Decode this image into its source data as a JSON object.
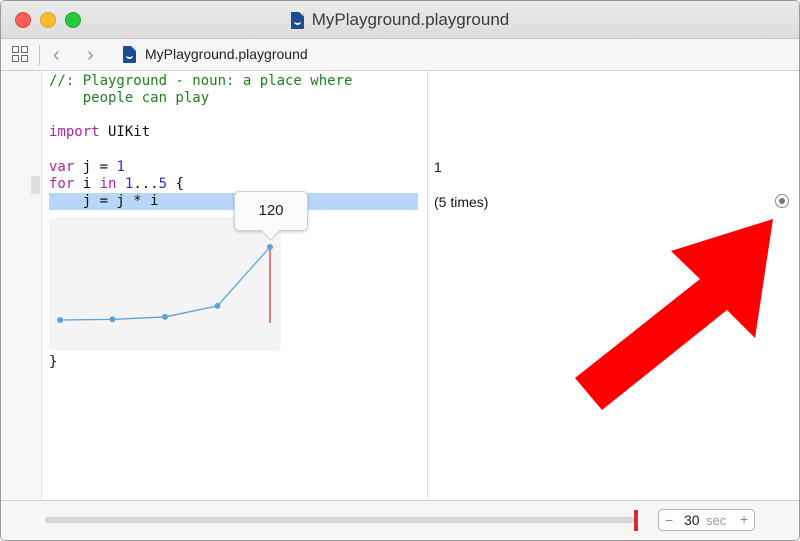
{
  "window": {
    "title": "MyPlayground.playground"
  },
  "jumpbar": {
    "back_label": "‹",
    "forward_label": "›",
    "file_label": "MyPlayground.playground"
  },
  "editor": {
    "lines": {
      "l1": "//: Playground - noun: a place where",
      "l2": "    people can play",
      "l3_kw": "import",
      "l3_rest": " UIKit",
      "l4_kw": "var",
      "l4_mid": " j = ",
      "l4_num": "1",
      "l5_kw1": "for",
      "l5_mid": " i ",
      "l5_kw2": "in",
      "l5_sp": " ",
      "l5_num1": "1",
      "l5_range": "...",
      "l5_num2": "5",
      "l5_end": " {",
      "l6": "    j = j * i",
      "l7": "}"
    }
  },
  "results": {
    "line_var": "1",
    "line_loop": "(5 times)"
  },
  "chart_data": {
    "type": "line",
    "x": [
      1,
      2,
      3,
      4,
      5
    ],
    "values": [
      1,
      2,
      6,
      24,
      120
    ],
    "selected_index": 4,
    "tooltip": "120",
    "color": "#5aa2dc",
    "marker_color": "#e0282c"
  },
  "timeline": {
    "value": "30",
    "unit": "sec",
    "minus_label": "−",
    "plus_label": "+",
    "progress": 1.0,
    "marker_color": "#e0282c"
  },
  "annotation": {
    "arrow_color": "#ff0000"
  }
}
